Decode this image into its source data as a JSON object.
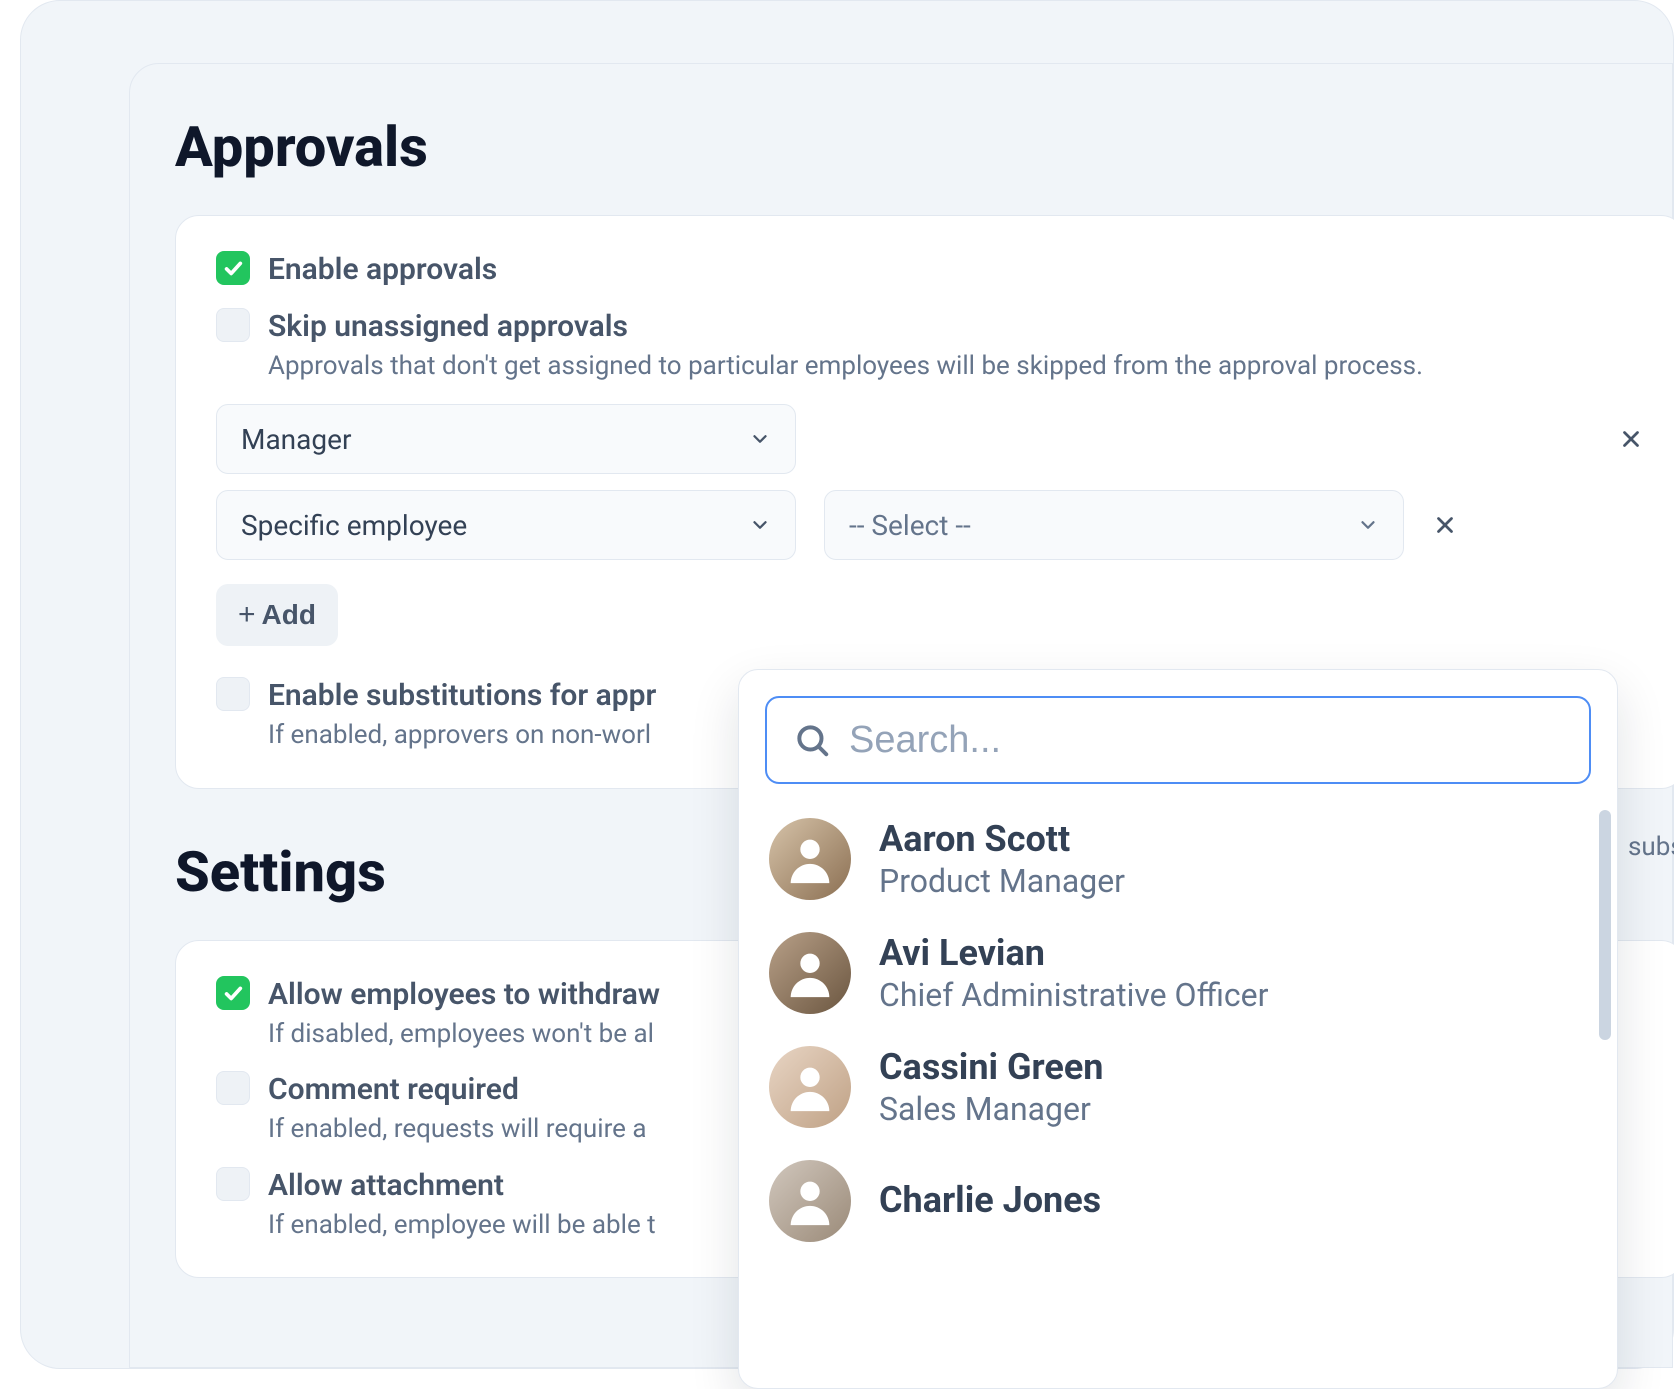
{
  "sections": {
    "approvals": {
      "title": "Approvals"
    },
    "settings": {
      "title": "Settings"
    }
  },
  "approvals": {
    "enable": {
      "label": "Enable approvals",
      "checked": true
    },
    "skip": {
      "label": "Skip unassigned approvals",
      "desc": "Approvals that don't get assigned to particular employees will be skipped from the approval process.",
      "checked": false
    },
    "rows": [
      {
        "type_label": "Manager",
        "employee_label": null
      },
      {
        "type_label": "Specific employee",
        "employee_label": "-- Select --"
      }
    ],
    "add_label": "Add",
    "substitutions": {
      "label": "Enable substitutions for appr",
      "desc": "If enabled, approvers on non-worl",
      "desc_tail": "substitutor.",
      "checked": false
    }
  },
  "settings": {
    "withdraw": {
      "label": "Allow employees to withdraw",
      "desc": "If disabled, employees won't be al",
      "checked": true
    },
    "comment": {
      "label": "Comment required",
      "desc": "If enabled, requests will require a",
      "checked": false
    },
    "attachment": {
      "label": "Allow attachment",
      "desc": "If enabled, employee will be able t",
      "checked": false
    }
  },
  "dropdown": {
    "search_placeholder": "Search...",
    "employees": [
      {
        "name": "Aaron Scott",
        "role": "Product Manager"
      },
      {
        "name": "Avi Levian",
        "role": "Chief Administrative Officer"
      },
      {
        "name": "Cassini Green",
        "role": "Sales Manager"
      },
      {
        "name": "Charlie Jones",
        "role": ""
      }
    ]
  }
}
